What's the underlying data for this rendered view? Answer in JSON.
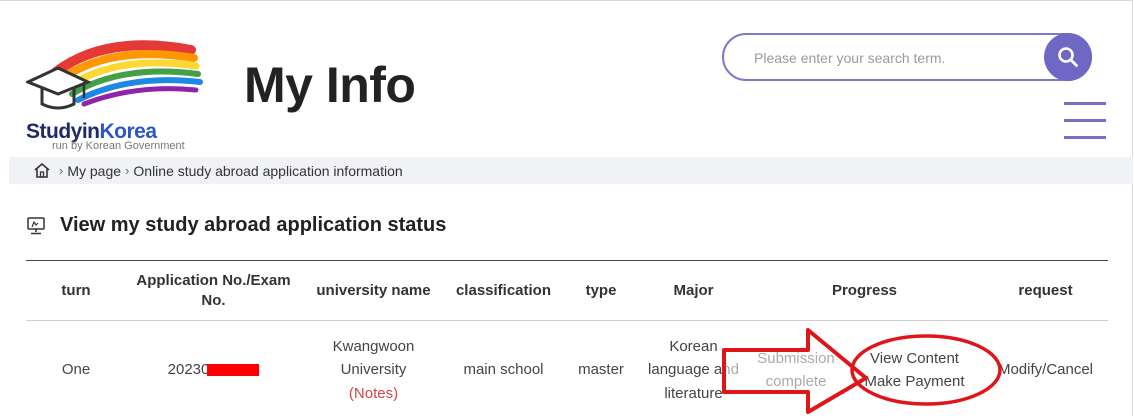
{
  "header": {
    "logo": {
      "brand_main": "Studyin",
      "brand_accent": "Korea",
      "sub": "run by Korean Government"
    },
    "title": "My Info",
    "search": {
      "placeholder": "Please enter your search term.",
      "value": ""
    },
    "icons": {
      "search": "search-icon",
      "menu": "hamburger-menu-icon",
      "home": "home-icon"
    },
    "accent_color": "#6f67c4"
  },
  "breadcrumb": {
    "items": [
      "My page",
      "Online study abroad application information"
    ]
  },
  "section": {
    "title": "View my study abroad application status"
  },
  "table": {
    "headers": [
      "turn",
      "Application No./Exam No.",
      "university name",
      "classification",
      "type",
      "Major",
      "Progress",
      "request"
    ],
    "rows": [
      {
        "turn": "One",
        "application_no": "20230",
        "university_line1": "Kwangwoon",
        "university_line2": "University",
        "notes": "(Notes)",
        "classification": "main school",
        "type": "master",
        "major_line1": "Korean",
        "major_line2": "language and",
        "major_line3": "literature",
        "status_line1": "Submission",
        "status_line2": "complete",
        "view_content": "View Content",
        "make_payment": "Make Payment",
        "request": "Modify/Cancel"
      }
    ]
  },
  "annotation_color": "#e0151a"
}
